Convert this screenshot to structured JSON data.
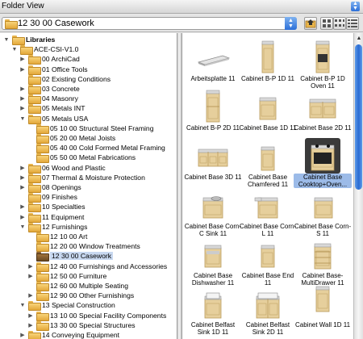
{
  "top_label": "Folder View",
  "path": "12 30 00 Casework",
  "tree": [
    {
      "label": "Libraries",
      "depth": 0,
      "expanded": true,
      "bold": true
    },
    {
      "label": "ACE-CSI-V1.0",
      "depth": 1,
      "expanded": true
    },
    {
      "label": "00 ArchiCad",
      "depth": 2,
      "expanded": false
    },
    {
      "label": "01 Office Tools",
      "depth": 2,
      "expanded": false
    },
    {
      "label": "02 Existing Conditions",
      "depth": 2,
      "leaf": true
    },
    {
      "label": "03 Concrete",
      "depth": 2,
      "expanded": false
    },
    {
      "label": "04 Masonry",
      "depth": 2,
      "expanded": false
    },
    {
      "label": "05 Metals INT",
      "depth": 2,
      "expanded": false
    },
    {
      "label": "05 Metals USA",
      "depth": 2,
      "expanded": true
    },
    {
      "label": "05 10 00 Structural Steel Framing",
      "depth": 3,
      "leaf": true
    },
    {
      "label": "05 20 00 Metal Joists",
      "depth": 3,
      "leaf": true
    },
    {
      "label": "05 40 00 Cold Formed Metal Framing",
      "depth": 3,
      "leaf": true
    },
    {
      "label": "05 50 00 Metal Fabrications",
      "depth": 3,
      "leaf": true
    },
    {
      "label": "06 Wood and Plastic",
      "depth": 2,
      "expanded": false
    },
    {
      "label": "07 Thermal & Moisture Protection",
      "depth": 2,
      "expanded": false
    },
    {
      "label": "08 Openings",
      "depth": 2,
      "expanded": false
    },
    {
      "label": "09 Finishes",
      "depth": 2,
      "leaf": true
    },
    {
      "label": "10 Specialties",
      "depth": 2,
      "expanded": false
    },
    {
      "label": "11 Equipment",
      "depth": 2,
      "expanded": false
    },
    {
      "label": "12 Furnishings",
      "depth": 2,
      "expanded": true
    },
    {
      "label": "12 10 00 Art",
      "depth": 3,
      "leaf": true
    },
    {
      "label": "12 20 00 Window Treatments",
      "depth": 3,
      "leaf": true
    },
    {
      "label": "12 30 00 Casework",
      "depth": 3,
      "leaf": true,
      "selected": true
    },
    {
      "label": "12 40 00 Furnishings and Accessories",
      "depth": 3,
      "expanded": false
    },
    {
      "label": "12 50 00 Furniture",
      "depth": 3,
      "expanded": false
    },
    {
      "label": "12 60 00 Multiple Seating",
      "depth": 3,
      "leaf": true
    },
    {
      "label": "12 90 00 Other Furnishings",
      "depth": 3,
      "expanded": false
    },
    {
      "label": "13 Special Construction",
      "depth": 2,
      "expanded": true
    },
    {
      "label": "13 10 00 Special Facility Components",
      "depth": 3,
      "expanded": false
    },
    {
      "label": "13 30 00 Special Structures",
      "depth": 3,
      "expanded": false
    },
    {
      "label": "14 Conveying Equipment",
      "depth": 2,
      "expanded": false
    }
  ],
  "items": [
    {
      "name": "Arbeitsplatte 11",
      "kind": "top"
    },
    {
      "name": "Cabinet B-P 1D 11",
      "kind": "tall"
    },
    {
      "name": "Cabinet B-P 1D Oven 11",
      "kind": "oven"
    },
    {
      "name": "Cabinet B-P 2D 11",
      "kind": "tall2"
    },
    {
      "name": "Cabinet Base 1D 11",
      "kind": "base1"
    },
    {
      "name": "Cabinet Base 2D 11",
      "kind": "base2"
    },
    {
      "name": "Cabinet Base 3D 11",
      "kind": "base3"
    },
    {
      "name": "Cabinet Base Chamfered 11",
      "kind": "chamfer"
    },
    {
      "name": "Cabinet Base Cooktop+Oven...",
      "kind": "cooktop",
      "selected": true
    },
    {
      "name": "Cabinet Base Corn-C Sink 11",
      "kind": "cornsink"
    },
    {
      "name": "Cabinet Base Corn-L 11",
      "kind": "cornl"
    },
    {
      "name": "Cabinet Base Corn-S 11",
      "kind": "corns"
    },
    {
      "name": "Cabinet Base Dishwasher 11",
      "kind": "dish"
    },
    {
      "name": "Cabinet Base End 11",
      "kind": "end"
    },
    {
      "name": "Cabinet Base-MultiDrawer 11",
      "kind": "drawers"
    },
    {
      "name": "Cabinet Belfast Sink 1D 11",
      "kind": "sink1"
    },
    {
      "name": "Cabinet Belfast Sink 2D 11",
      "kind": "sink2"
    },
    {
      "name": "Cabinet Wall 1D 11",
      "kind": "wall"
    }
  ]
}
